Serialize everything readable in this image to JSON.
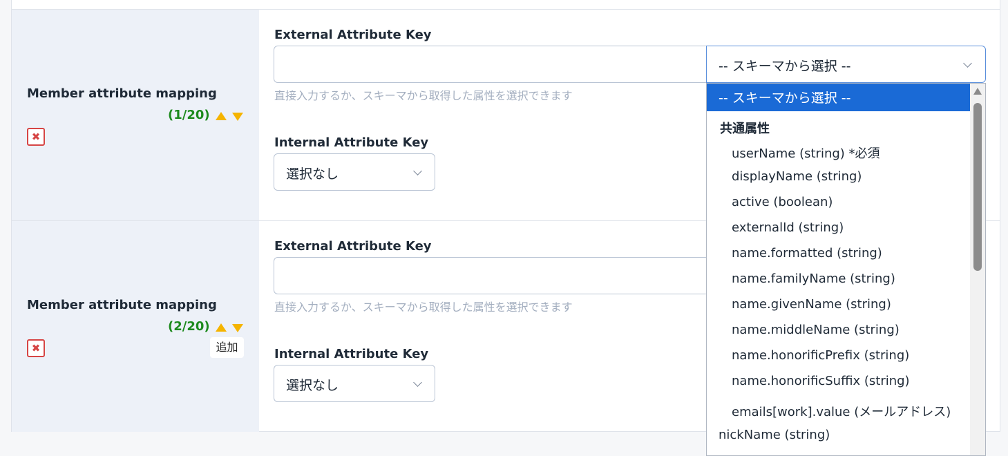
{
  "mappings": [
    {
      "title": "Member attribute mapping",
      "counter": "(1/20)",
      "external_label": "External Attribute Key",
      "external_value": "",
      "schema_select_value": "-- スキーマから選択 --",
      "help": "直接入力するか、スキーマから取得した属性を選択できます",
      "internal_label": "Internal Attribute Key",
      "internal_value": "選択なし"
    },
    {
      "title": "Member attribute mapping",
      "counter": "(2/20)",
      "external_label": "External Attribute Key",
      "external_value": "",
      "help": "直接入力するか、スキーマから取得した属性を選択できます",
      "internal_label": "Internal Attribute Key",
      "internal_value": "選択なし"
    }
  ],
  "tooltip": "追加",
  "delete_symbol": "✖",
  "dropdown": {
    "selected": "-- スキーマから選択 --",
    "group": "共通属性",
    "options": [
      "userName (string) *必須",
      "displayName (string)",
      "active (boolean)",
      "externalId (string)",
      "name.formatted (string)",
      "name.familyName (string)",
      "name.givenName (string)",
      "name.middleName (string)",
      "name.honorificPrefix (string)",
      "name.honorificSuffix (string)",
      "emails[work].value (メールアドレス)"
    ],
    "flat_options": [
      "nickName (string)"
    ]
  },
  "colors": {
    "counter": "#1d8a1d",
    "arrow": "#f5b400",
    "delete": "#d64545",
    "selected_option": "#1a6ad6",
    "left_column_bg": "#edf1f8"
  }
}
